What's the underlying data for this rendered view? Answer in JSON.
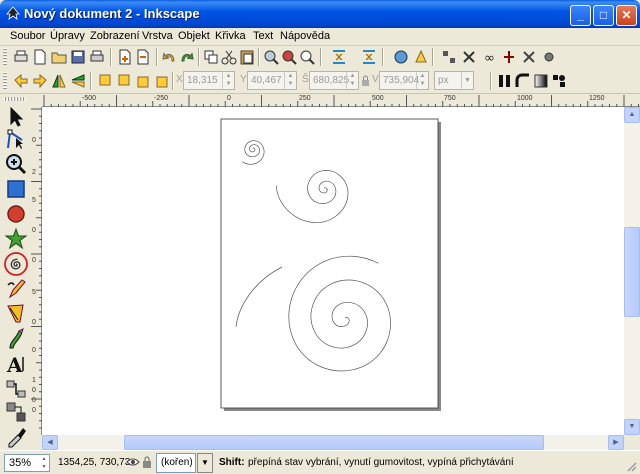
{
  "window": {
    "title": "Nový dokument 2 - Inkscape",
    "controls": {
      "minimize": "_",
      "maximize": "□",
      "close": "✕"
    }
  },
  "menubar": {
    "items": [
      "Soubor",
      "Úpravy",
      "Zobrazení",
      "Vrstva",
      "Objekt",
      "Křivka",
      "Text",
      "Nápověda"
    ]
  },
  "selection_toolbar": {
    "x_label": "X",
    "x_value": "18,315",
    "y_label": "Y",
    "y_value": "40,467",
    "w_label": "Š",
    "w_value": "680,825",
    "h_label": "V",
    "h_value": "735,904",
    "unit": "px"
  },
  "ruler": {
    "h_labels": [
      "-500",
      "-250",
      "0",
      "250",
      "500",
      "750",
      "1000",
      "1250"
    ],
    "v_labels": [
      "0",
      "2",
      "5",
      "0",
      "0",
      "5",
      "0",
      "0",
      "1",
      "0",
      "0",
      "0"
    ]
  },
  "toolbox": {
    "tools": [
      "selector-tool",
      "node-tool",
      "zoom-tool",
      "rectangle-tool",
      "ellipse-tool",
      "star-tool",
      "spiral-tool",
      "pencil-tool",
      "pen-tool",
      "calligraphy-tool",
      "text-tool",
      "connector-tool",
      "gradient-tool",
      "dropper-tool"
    ],
    "active": "spiral-tool"
  },
  "statusbar": {
    "zoom": "35%",
    "coords": "1354,25, 730,73",
    "layer": "(kořen)",
    "hint_key": "Shift:",
    "hint_text": "přepíná stav vybrání, vynutí gumovitost, vypíná přichytávání"
  },
  "colors": {
    "title_bar": "#0055e5",
    "active_tool_ring": "#d02020",
    "background": "#ece9d8"
  }
}
